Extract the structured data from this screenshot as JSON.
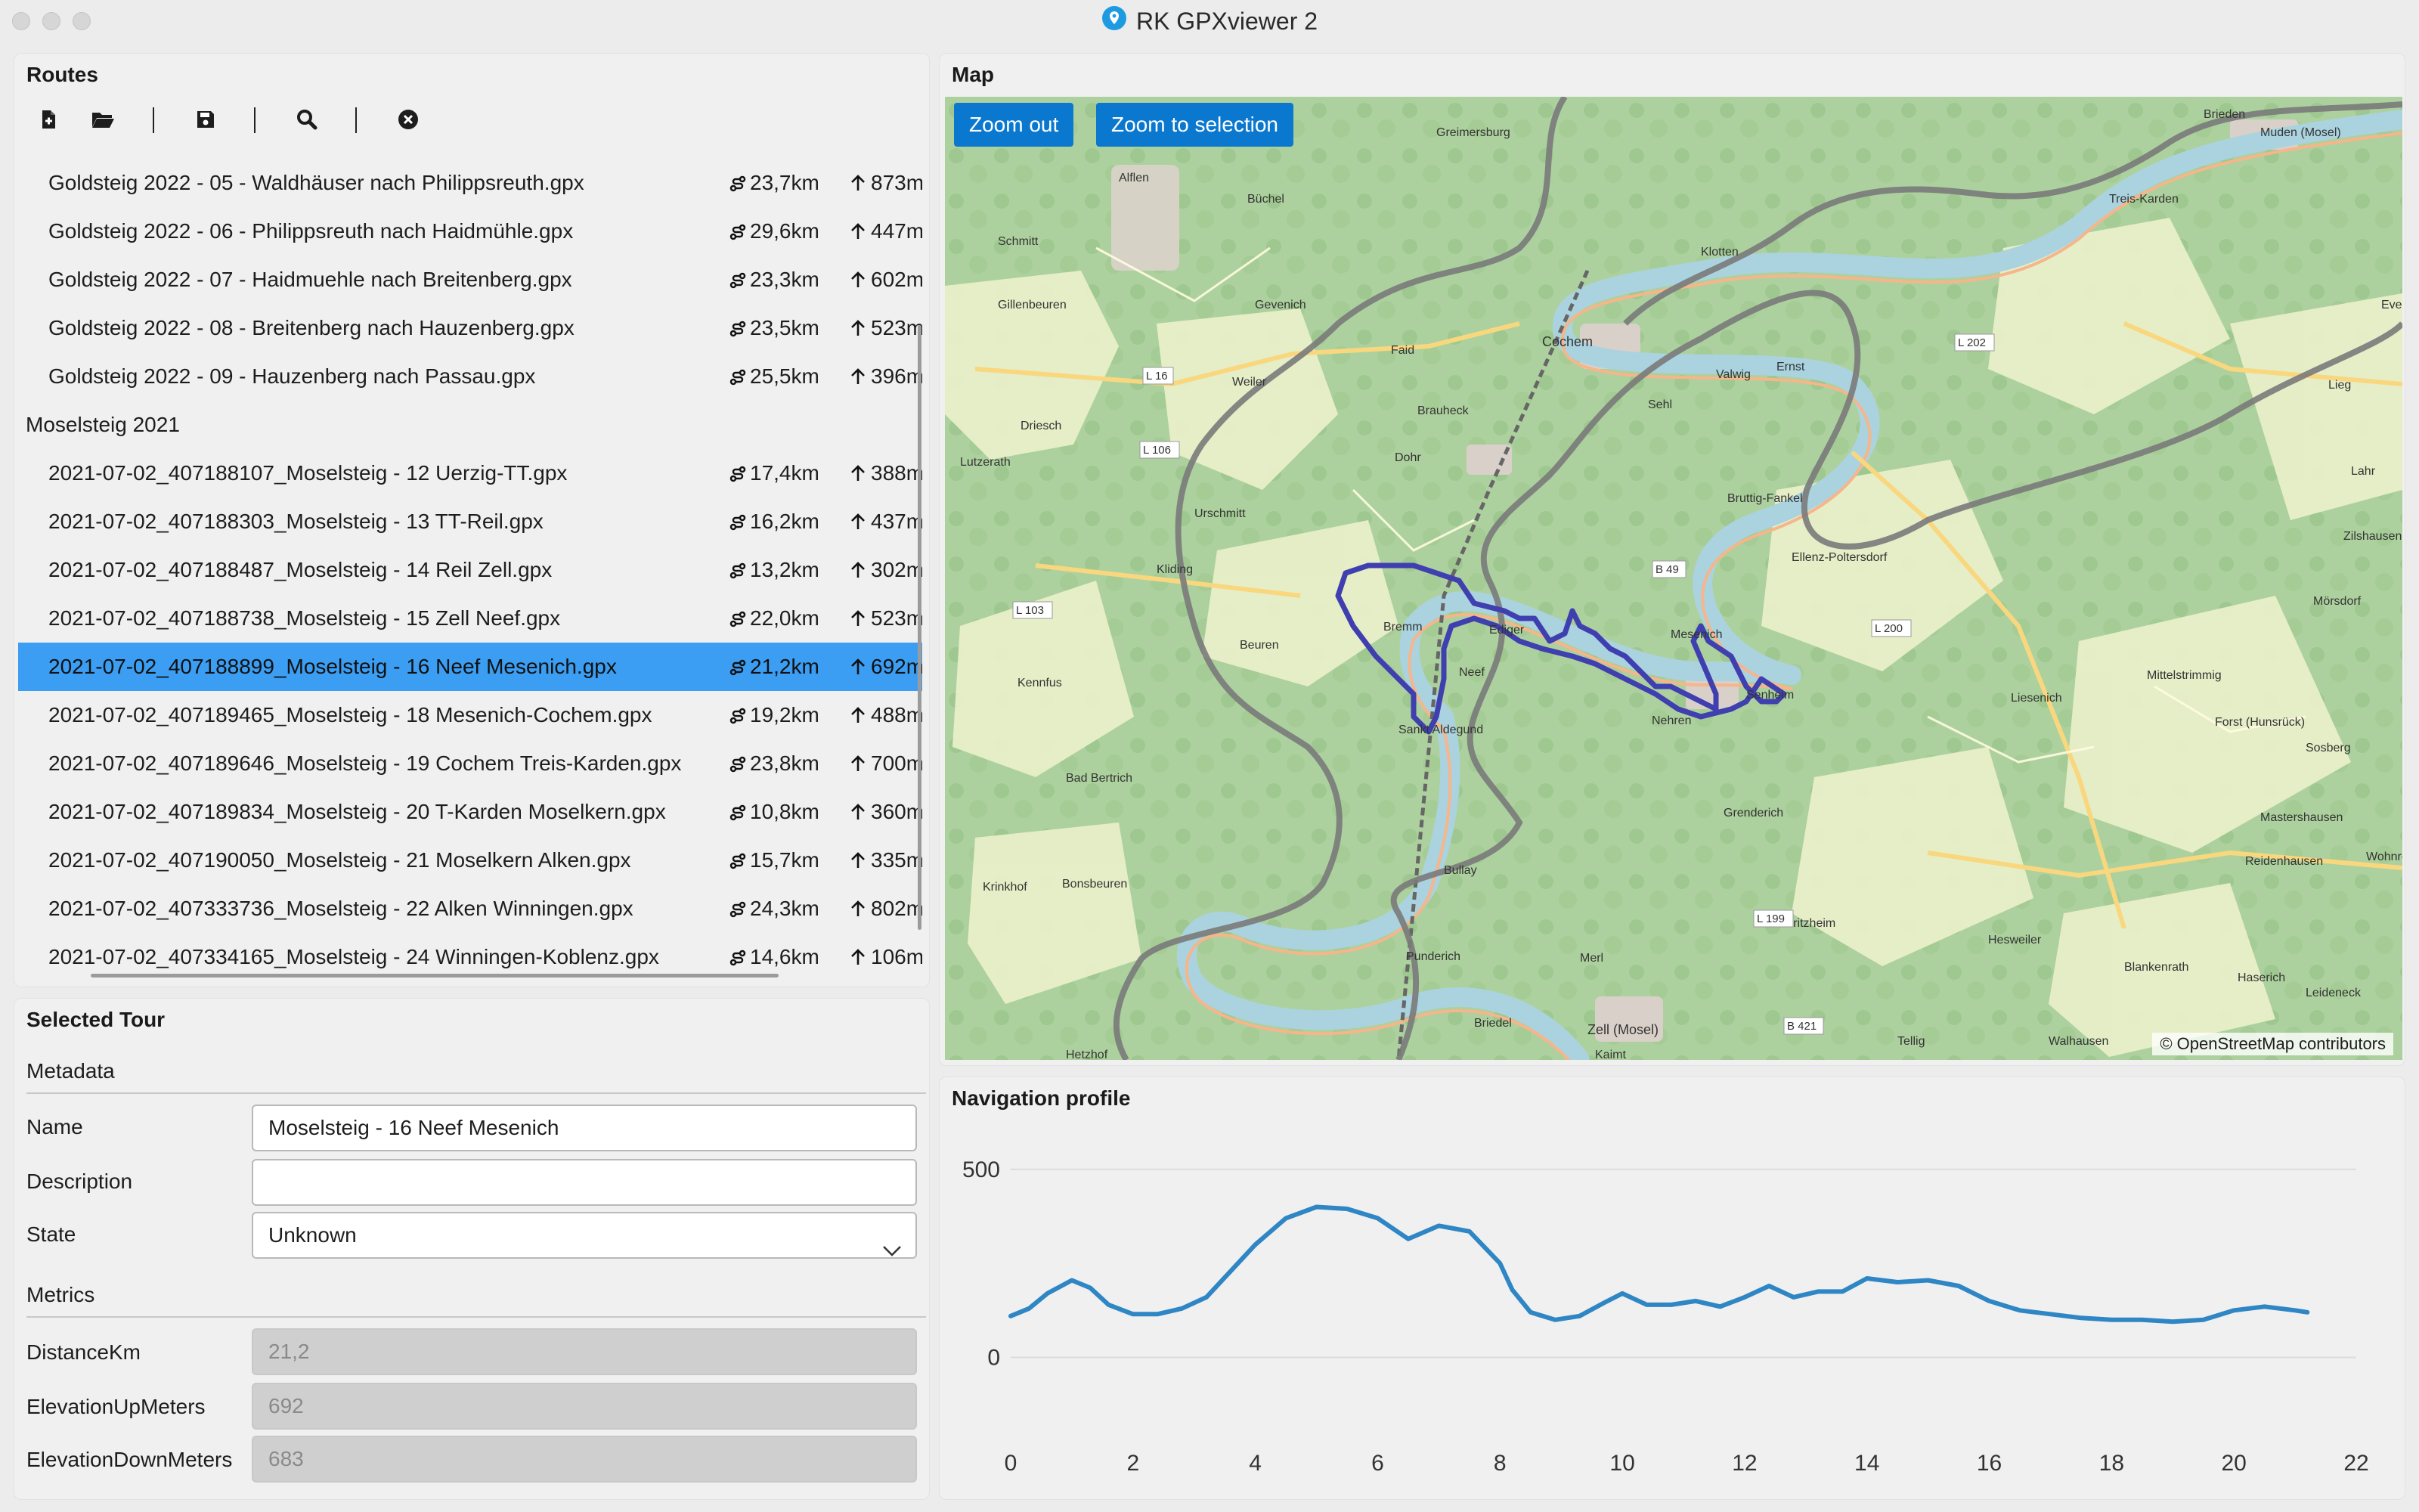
{
  "window": {
    "title": "RK GPXviewer 2"
  },
  "routes": {
    "title": "Routes",
    "toolbar": {
      "new_icon": "new-file-icon",
      "open_icon": "folder-open-icon",
      "save_icon": "save-icon",
      "search_icon": "search-icon",
      "close_icon": "close-circle-icon"
    },
    "items": [
      {
        "name": "Goldsteig 2022 - 05 - Waldhäuser nach Philippsreuth.gpx",
        "dist": "23,7km",
        "elev": "873m"
      },
      {
        "name": "Goldsteig 2022 - 06 - Philippsreuth nach Haidmühle.gpx",
        "dist": "29,6km",
        "elev": "447m"
      },
      {
        "name": "Goldsteig 2022 - 07 - Haidmuehle nach Breitenberg.gpx",
        "dist": "23,3km",
        "elev": "602m"
      },
      {
        "name": "Goldsteig 2022 - 08 - Breitenberg nach Hauzenberg.gpx",
        "dist": "23,5km",
        "elev": "523m"
      },
      {
        "name": "Goldsteig 2022 - 09 - Hauzenberg nach Passau.gpx",
        "dist": "25,5km",
        "elev": "396m"
      },
      {
        "group": true,
        "name": "Moselsteig 2021"
      },
      {
        "name": "2021-07-02_407188107_Moselsteig - 12 Uerzig-TT.gpx",
        "dist": "17,4km",
        "elev": "388m"
      },
      {
        "name": "2021-07-02_407188303_Moselsteig - 13 TT-Reil.gpx",
        "dist": "16,2km",
        "elev": "437m"
      },
      {
        "name": "2021-07-02_407188487_Moselsteig - 14 Reil Zell.gpx",
        "dist": "13,2km",
        "elev": "302m"
      },
      {
        "name": "2021-07-02_407188738_Moselsteig - 15 Zell Neef.gpx",
        "dist": "22,0km",
        "elev": "523m"
      },
      {
        "name": "2021-07-02_407188899_Moselsteig - 16 Neef Mesenich.gpx",
        "dist": "21,2km",
        "elev": "692m",
        "selected": true
      },
      {
        "name": "2021-07-02_407189465_Moselsteig - 18 Mesenich-Cochem.gpx",
        "dist": "19,2km",
        "elev": "488m"
      },
      {
        "name": "2021-07-02_407189646_Moselsteig - 19 Cochem Treis-Karden.gpx",
        "dist": "23,8km",
        "elev": "700m"
      },
      {
        "name": "2021-07-02_407189834_Moselsteig - 20 T-Karden Moselkern.gpx",
        "dist": "10,8km",
        "elev": "360m"
      },
      {
        "name": "2021-07-02_407190050_Moselsteig - 21 Moselkern Alken.gpx",
        "dist": "15,7km",
        "elev": "335m"
      },
      {
        "name": "2021-07-02_407333736_Moselsteig - 22 Alken Winningen.gpx",
        "dist": "24,3km",
        "elev": "802m"
      },
      {
        "name": "2021-07-02_407334165_Moselsteig - 24 Winningen-Koblenz.gpx",
        "dist": "14,6km",
        "elev": "106m"
      }
    ]
  },
  "selected_tour": {
    "title": "Selected Tour",
    "metadata_label": "Metadata",
    "name_label": "Name",
    "name_value": "Moselsteig - 16 Neef Mesenich",
    "description_label": "Description",
    "description_value": "",
    "state_label": "State",
    "state_value": "Unknown",
    "metrics_label": "Metrics",
    "distance_label": "DistanceKm",
    "distance_value": "21,2",
    "elev_up_label": "ElevationUpMeters",
    "elev_up_value": "692",
    "elev_down_label": "ElevationDownMeters",
    "elev_down_value": "683"
  },
  "map": {
    "title": "Map",
    "zoom_out": "Zoom out",
    "zoom_selection": "Zoom to selection",
    "attribution": "© OpenStreetMap contributors",
    "places": [
      "Brieden",
      "Greimersburg",
      "Muden (Mosel)",
      "Alflen",
      "Büchel",
      "Treis-Karden",
      "Schmitt",
      "Klotten",
      "Gillenbeuren",
      "Gevenich",
      "Cochem",
      "Faid",
      "Valwig",
      "Ernst",
      "Weiler",
      "Sehl",
      "Brauheck",
      "Driesch",
      "Dohr",
      "Bruttig-Fankel",
      "Lutzerath",
      "Urschmitt",
      "Ellenz-Poltersdorf",
      "Kliding",
      "Bremm",
      "Ediger",
      "Mesenich",
      "Beuren",
      "Neef",
      "Senheim",
      "Kennfus",
      "Nehren",
      "Sankt Aldegund",
      "Bad Bertrich",
      "Grenderich",
      "Liesenich",
      "Mittelstrimmig",
      "Forst (Hunsrück)",
      "Sosberg",
      "Bullay",
      "Bonsbeuren",
      "Krinkhof",
      "Mastershausen",
      "Reidenhausen",
      "Moritzheim",
      "Hesweiler",
      "Blankenrath",
      "Haserich",
      "Punderich",
      "Merl",
      "Briedel",
      "Zell (Mosel)",
      "Kaimt",
      "Tellig",
      "Walhausen",
      "Lieg",
      "Lahr",
      "Zilshausen",
      "Mörsdorf",
      "Leideneck",
      "Wohnroth",
      "Evesh",
      "Hetzhof",
      "Alflen"
    ],
    "roads": [
      "L 16",
      "L 106",
      "L 103",
      "B 49",
      "L 200",
      "L 202",
      "L 199",
      "B 421"
    ]
  },
  "profile": {
    "title": "Navigation profile",
    "chart_data": {
      "type": "line",
      "title": "",
      "xlabel": "",
      "ylabel": "",
      "xlim": [
        0,
        22
      ],
      "ylim": [
        -200,
        600
      ],
      "x_ticks": [
        0,
        2,
        4,
        6,
        8,
        10,
        12,
        14,
        16,
        18,
        20,
        22
      ],
      "y_ticks": [
        0,
        500
      ],
      "series": [
        {
          "color": "#2f86c4",
          "x": [
            0,
            0.3,
            0.6,
            1,
            1.3,
            1.6,
            2,
            2.4,
            2.8,
            3.2,
            3.6,
            4,
            4.5,
            5,
            5.5,
            6,
            6.5,
            7,
            7.5,
            8,
            8.2,
            8.5,
            8.9,
            9.3,
            9.7,
            10,
            10.4,
            10.8,
            11.2,
            11.6,
            12,
            12.4,
            12.8,
            13.2,
            13.6,
            14,
            14.5,
            15,
            15.5,
            16,
            16.5,
            17,
            17.5,
            18,
            18.5,
            19,
            19.5,
            20,
            20.5,
            21,
            21.2
          ],
          "y": [
            110,
            130,
            170,
            205,
            185,
            140,
            115,
            115,
            130,
            160,
            230,
            300,
            370,
            400,
            395,
            370,
            315,
            350,
            335,
            250,
            180,
            120,
            100,
            110,
            145,
            170,
            140,
            140,
            150,
            135,
            160,
            190,
            160,
            175,
            175,
            210,
            200,
            205,
            190,
            150,
            125,
            115,
            105,
            100,
            100,
            95,
            100,
            125,
            135,
            125,
            120
          ]
        }
      ]
    }
  },
  "colors": {
    "accent": "#3b9ef3",
    "button": "#0b78d0",
    "route": "#2e2ea0",
    "line": "#2f86c4"
  }
}
